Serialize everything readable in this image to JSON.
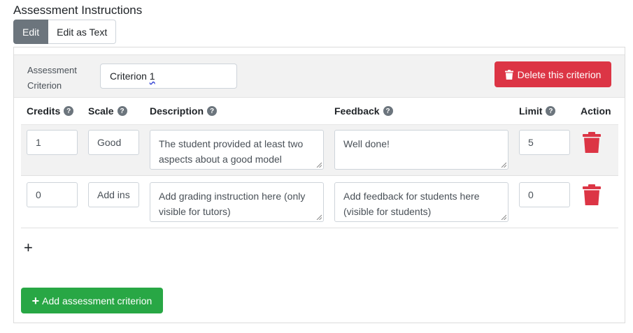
{
  "page": {
    "title": "Assessment Instructions"
  },
  "tabs": {
    "edit": "Edit",
    "edit_as_text": "Edit as Text"
  },
  "criterion": {
    "label": "Assessment Criterion",
    "name_value": "Criterion",
    "name_suffix": "1",
    "delete_label": "Delete this criterion"
  },
  "table": {
    "headers": {
      "credits": "Credits",
      "scale": "Scale",
      "description": "Description",
      "feedback": "Feedback",
      "limit": "Limit",
      "action": "Action"
    },
    "rows": [
      {
        "credits": "1",
        "scale": "Good",
        "description": "The student provided at least two aspects about a good model",
        "feedback": "Well done!",
        "limit": "5"
      },
      {
        "credits": "0",
        "scale": "Add ins",
        "description": "Add grading instruction here (only visible for tutors)",
        "feedback": "Add feedback for students here (visible for students)",
        "limit": "0"
      }
    ]
  },
  "add_instruction_symbol": "+",
  "add_criterion": {
    "icon": "+",
    "label": "Add assessment criterion"
  },
  "colors": {
    "danger": "#dc3545",
    "success": "#28a745",
    "secondary": "#6c757d"
  }
}
